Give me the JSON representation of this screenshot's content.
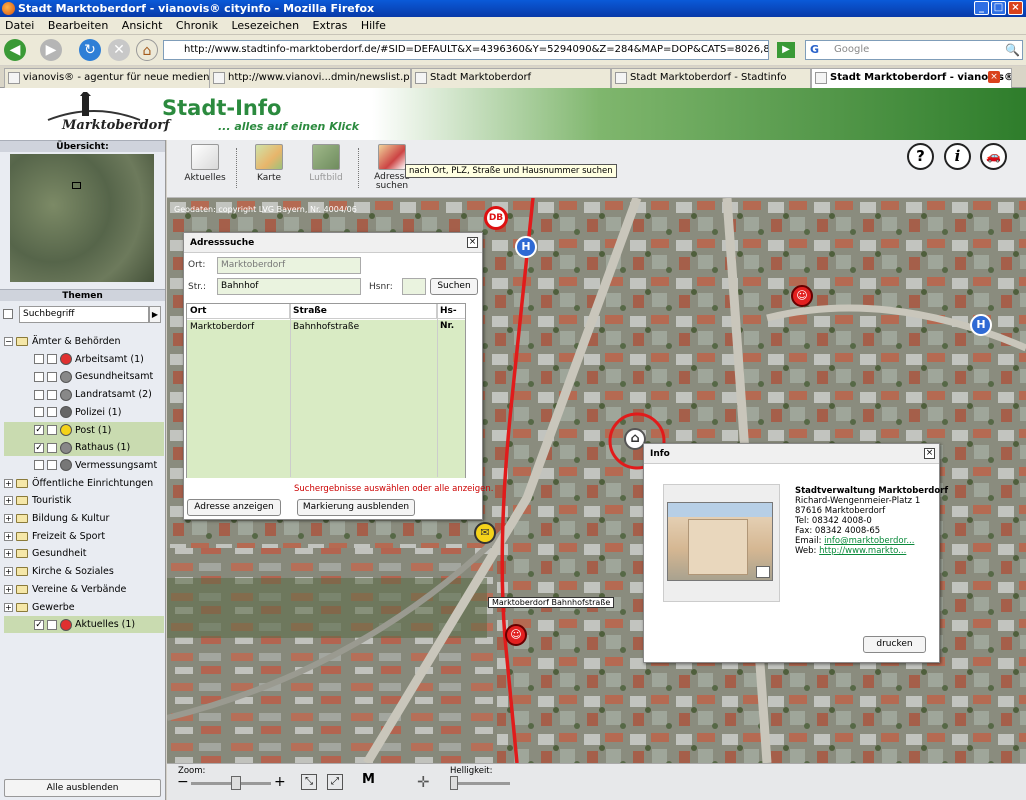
{
  "window": {
    "title": "Stadt Marktoberdorf - vianovis® cityinfo - Mozilla Firefox",
    "min": "_",
    "max": "□",
    "close": "×"
  },
  "menu": [
    "Datei",
    "Bearbeiten",
    "Ansicht",
    "Chronik",
    "Lesezeichen",
    "Extras",
    "Hilfe"
  ],
  "nav": {
    "url": "http://www.stadtinfo-marktoberdorf.de/#SID=DEFAULT&X=4396360&Y=5294090&Z=284&MAP=DOP&CATS=8026,8025,7702,8285,7685,8300&UI",
    "search_placeholder": "Google"
  },
  "tabs": [
    {
      "label": "vianovis® - agentur für neue medien"
    },
    {
      "label": "http://www.vianovi...dmin/newslist.php"
    },
    {
      "label": "Stadt Marktoberdorf"
    },
    {
      "label": "Stadt Marktoberdorf - Stadtinfo"
    },
    {
      "label": "Stadt Marktoberdorf - vianovis®..."
    }
  ],
  "header": {
    "logo_text": "Marktoberdorf",
    "title": "Stadt-Info",
    "subtitle": "... alles auf einen Klick"
  },
  "left": {
    "overview_label": "Übersicht:",
    "themes_label": "Themen",
    "search_term": "Suchbegriff",
    "tree": [
      {
        "label": "Ämter & Behörden",
        "type": "folder-open"
      },
      {
        "label": "Arbeitsamt (1)",
        "type": "item",
        "checked": false,
        "color": "#e03030"
      },
      {
        "label": "Gesundheitsamt",
        "type": "item",
        "checked": false,
        "color": "#888888"
      },
      {
        "label": "Landratsamt (2)",
        "type": "item",
        "checked": false,
        "color": "#888888"
      },
      {
        "label": "Polizei (1)",
        "type": "item",
        "checked": false,
        "color": "#666666"
      },
      {
        "label": "Post (1)",
        "type": "item",
        "checked": true,
        "color": "#f4d21a"
      },
      {
        "label": "Rathaus (1)",
        "type": "item",
        "checked": true,
        "color": "#888888"
      },
      {
        "label": "Vermessungsamt",
        "type": "item",
        "checked": false,
        "color": "#777777"
      },
      {
        "label": "Öffentliche Einrichtungen",
        "type": "folder"
      },
      {
        "label": "Touristik",
        "type": "folder"
      },
      {
        "label": "Bildung & Kultur",
        "type": "folder"
      },
      {
        "label": "Freizeit & Sport",
        "type": "folder"
      },
      {
        "label": "Gesundheit",
        "type": "folder"
      },
      {
        "label": "Kirche & Soziales",
        "type": "folder"
      },
      {
        "label": "Vereine & Verbände",
        "type": "folder"
      },
      {
        "label": "Gewerbe",
        "type": "folder"
      },
      {
        "label": "Aktuelles (1)",
        "type": "item",
        "checked": true,
        "color": "#e03030"
      }
    ],
    "hide_all": "Alle ausblenden"
  },
  "toolbar": {
    "aktuelles": "Aktuelles",
    "karte": "Karte",
    "luftbild": "Luftbild",
    "adresse": "Adresse suchen",
    "tooltip": "nach Ort, PLZ, Straße und Hausnummer suchen",
    "help": "?",
    "info": "i",
    "car": "🚗"
  },
  "map": {
    "attribution": "Geodaten: copyright LVG Bayern, Nr. 4004/06",
    "station_label": "Marktoberdorf Bahnhofstraße",
    "db": "DB",
    "h": "H"
  },
  "address_search": {
    "title": "Adresssuche",
    "ort_label": "Ort:",
    "ort_value": "Marktoberdorf",
    "str_label": "Str.:",
    "str_value": "Bahnhof",
    "hsnr_label": "Hsnr:",
    "search_btn": "Suchen",
    "columns": [
      "Ort",
      "Straße",
      "Hs-Nr."
    ],
    "row": [
      "Marktoberdorf",
      "Bahnhofstraße",
      ""
    ],
    "message": "Suchergebnisse auswählen oder alle anzeigen.",
    "show_btn": "Adresse anzeigen",
    "hide_btn": "Markierung ausblenden"
  },
  "info": {
    "title": "Info",
    "name": "Stadtverwaltung Marktoberdorf",
    "street": "Richard-Wengenmeier-Platz 1",
    "city": "87616 Marktoberdorf",
    "tel": "Tel: 08342 4008-0",
    "fax": "Fax: 08342 4008-65",
    "email_label": "Email:",
    "email": "info@marktoberdor...",
    "web_label": "Web:",
    "web": "http://www.markto...",
    "print_btn": "drucken"
  },
  "status": {
    "zoom": "Zoom:",
    "brightness": "Helligkeit:",
    "minus": "−",
    "plus": "+",
    "m": "M"
  }
}
